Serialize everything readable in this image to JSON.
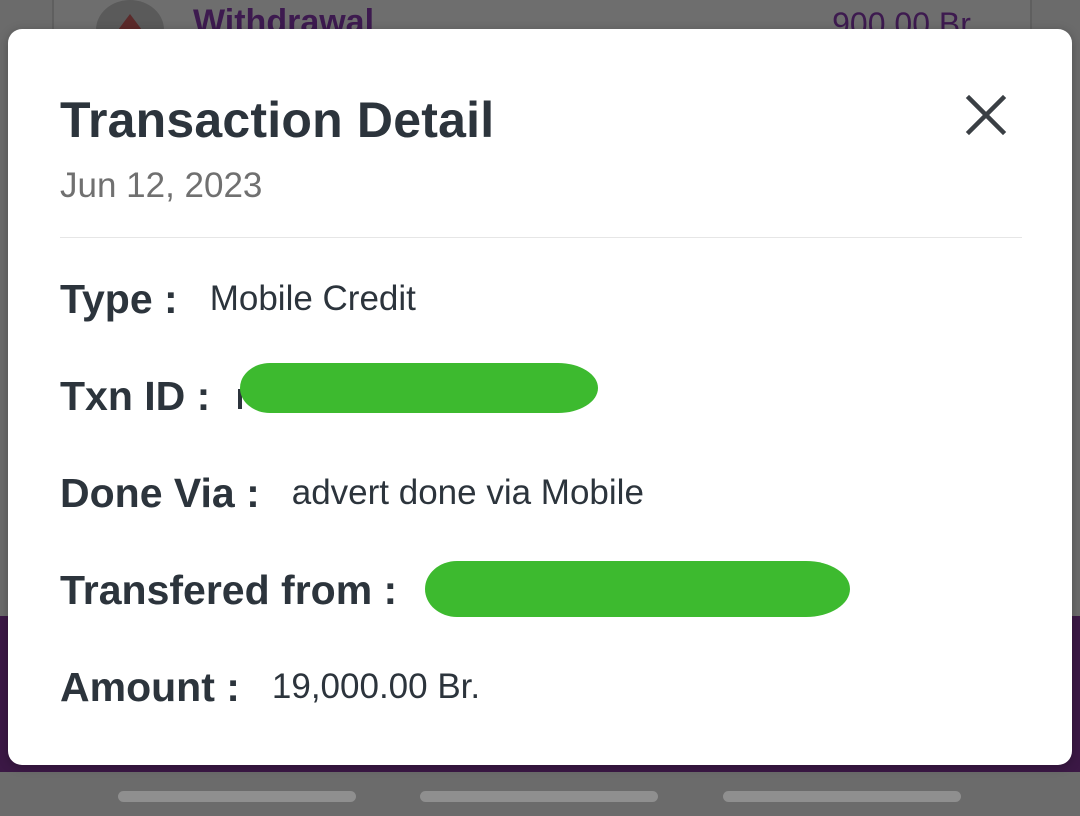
{
  "background": {
    "list_item_title": "Withdrawal",
    "list_item_amount": "900.00 Br."
  },
  "modal": {
    "title": "Transaction Detail",
    "date": "Jun 12, 2023",
    "close_icon": "close-icon",
    "rows": [
      {
        "label": "Type :",
        "value": "Mobile Credit"
      },
      {
        "label": "Txn ID :",
        "value": ""
      },
      {
        "label": "Done Via :",
        "value": "advert done via Mobile"
      },
      {
        "label": "Transfered from :",
        "value": ""
      },
      {
        "label": "Amount :",
        "value": "19,000.00 Br."
      }
    ]
  },
  "colors": {
    "redaction": "#3dba2f",
    "brand_purple": "#3b1845",
    "text_dark": "#2c343c",
    "text_muted": "#707070"
  }
}
